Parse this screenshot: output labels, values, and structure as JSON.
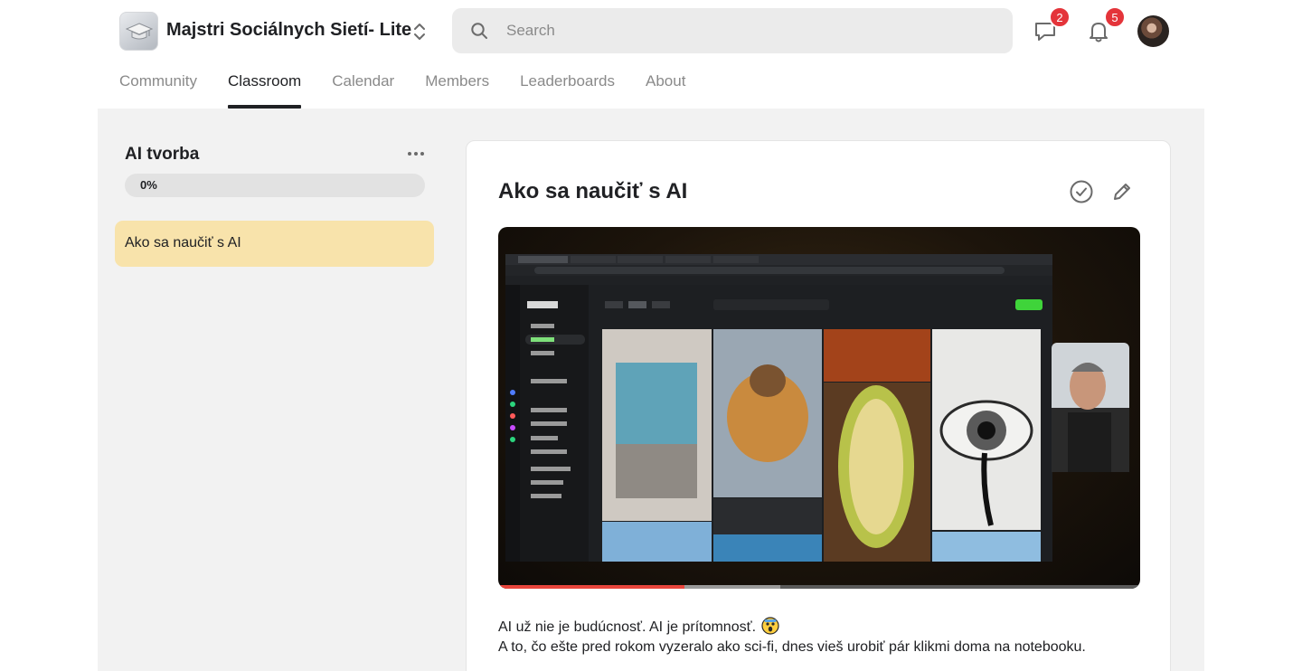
{
  "header": {
    "group_name": "Majstri Sociálnych Sietí- Lite",
    "search_placeholder": "Search",
    "chat_badge": "2",
    "notification_badge": "5",
    "icons": {
      "logo": "graduation-cap-icon",
      "switch": "chevron-up-down-icon",
      "search": "search-icon",
      "chat": "chat-bubble-icon",
      "notifications": "bell-icon"
    }
  },
  "nav": {
    "tabs": [
      {
        "label": "Community",
        "active": false
      },
      {
        "label": "Classroom",
        "active": true
      },
      {
        "label": "Calendar",
        "active": false
      },
      {
        "label": "Members",
        "active": false
      },
      {
        "label": "Leaderboards",
        "active": false
      },
      {
        "label": "About",
        "active": false
      }
    ]
  },
  "sidebar": {
    "course_title": "AI tvorba",
    "progress_label": "0%",
    "progress": 0,
    "lessons": [
      {
        "label": "Ako sa naučiť s AI",
        "active": true
      }
    ]
  },
  "lesson": {
    "title": "Ako sa naučiť s AI",
    "video_progress": 0.29,
    "video_buffered": 0.44,
    "description_line1": "AI už nie je budúcnosť. AI je prítomnosť.",
    "description_line2": "A to, čo ešte pred rokom vyzeralo ako sci-fi, dnes vieš urobiť pár klikmi doma na notebooku.",
    "icons": {
      "complete": "check-circle-icon",
      "edit": "pencil-icon",
      "emoji": "shocked-face-emoji"
    }
  },
  "colors": {
    "badge": "#e4343a",
    "active_lesson_bg": "#f8e3ab",
    "video_progress": "#e8453c"
  }
}
